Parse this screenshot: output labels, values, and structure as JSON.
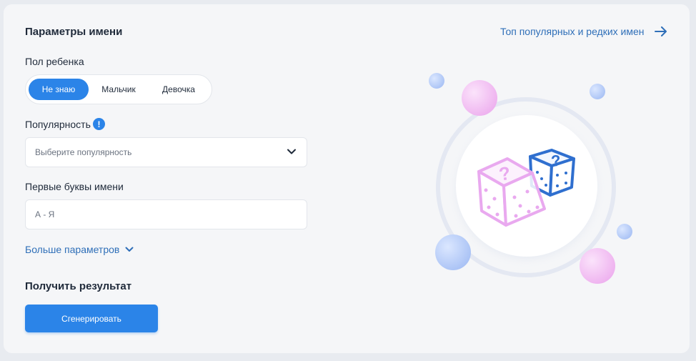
{
  "form": {
    "title": "Параметры имени",
    "top_link": "Топ популярных и редких имен",
    "gender": {
      "label": "Пол ребенка",
      "options": [
        "Не знаю",
        "Мальчик",
        "Девочка"
      ],
      "selected": "Не знаю"
    },
    "popularity": {
      "label": "Популярность",
      "info_badge": "!",
      "placeholder": "Выберите популярность"
    },
    "first_letters": {
      "label": "Первые буквы имени",
      "placeholder": "А - Я"
    },
    "more_params": "Больше параметров",
    "result_title": "Получить результат",
    "generate_button": "Сгенерировать"
  },
  "colors": {
    "accent": "#2b84e8",
    "link": "#2f6fb8",
    "pink_die": "#e9a9ef",
    "blue_die": "#2f6fcf"
  },
  "icons": {
    "arrow": "arrow-right-icon",
    "chevron": "chevron-down-icon",
    "info": "exclamation-icon",
    "illustration": "dice-icon"
  }
}
